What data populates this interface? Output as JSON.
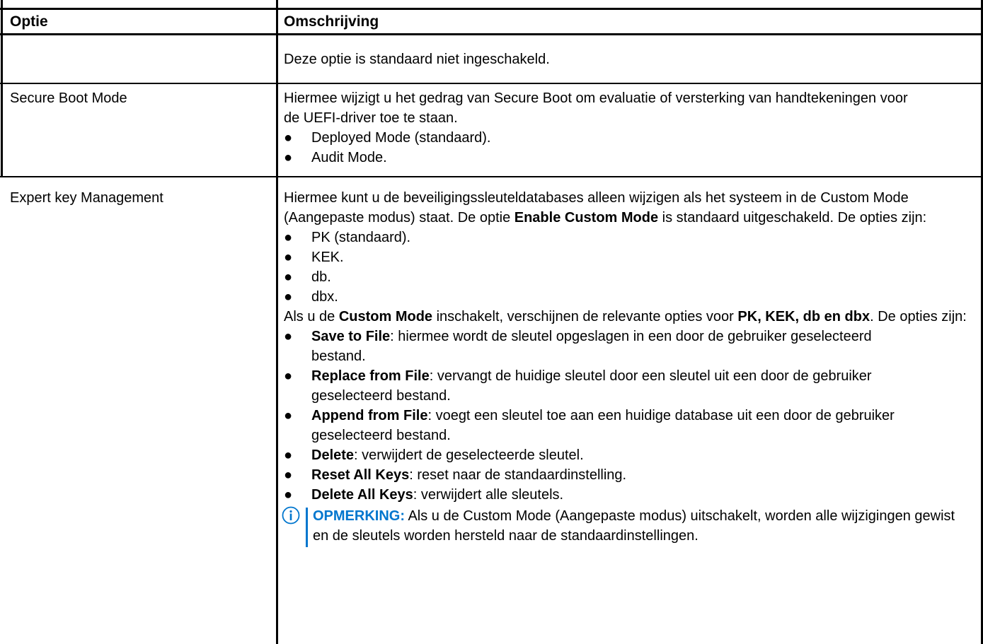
{
  "table": {
    "headers": {
      "option": "Optie",
      "description": "Omschrijving"
    },
    "rows": [
      {
        "option": "",
        "desc_text": "Deze optie is standaard niet ingeschakeld."
      },
      {
        "option": "Secure Boot Mode",
        "desc_text": "Hiermee wijzigt u het gedrag van Secure Boot om evaluatie of versterking van handtekeningen voor de UEFI-driver toe te staan.",
        "bullets": [
          "Deployed Mode (standaard).",
          "Audit Mode."
        ]
      },
      {
        "option": "Expert key Management",
        "intro_1": "Hiermee kunt u de beveiligingssleuteldatabases alleen wijzigen als het systeem in de Custom Mode (Aangepaste modus) staat. De optie ",
        "intro_bold": "Enable Custom Mode",
        "intro_2": " is standaard uitgeschakeld. De opties zijn:",
        "key_bullets": [
          "PK (standaard).",
          "KEK.",
          "db.",
          "dbx."
        ],
        "mid_1": "Als u de ",
        "mid_bold_1": "Custom Mode",
        "mid_2": " inschakelt, verschijnen de relevante opties voor ",
        "mid_bold_2": "PK, KEK, db en dbx",
        "mid_3": ". De opties zijn:",
        "action_bullets": [
          {
            "term": "Save to File",
            "text": ": hiermee wordt de sleutel opgeslagen in een door de gebruiker geselecteerd bestand."
          },
          {
            "term": "Replace from File",
            "text": ": vervangt de huidige sleutel door een sleutel uit een door de gebruiker geselecteerd bestand."
          },
          {
            "term": "Append from File",
            "text": ": voegt een sleutel toe aan een huidige database uit een door de gebruiker geselecteerd bestand."
          },
          {
            "term": "Delete",
            "text": ": verwijdert de geselecteerde sleutel."
          },
          {
            "term": "Reset All Keys",
            "text": ": reset naar de standaardinstelling."
          },
          {
            "term": "Delete All Keys",
            "text": ": verwijdert alle sleutels."
          }
        ],
        "note": {
          "icon": "info-circle-icon",
          "label": "OPMERKING:",
          "text": " Als u de Custom Mode (Aangepaste modus) uitschakelt, worden alle wijzigingen gewist en de sleutels worden hersteld naar de standaardinstellingen."
        }
      }
    ]
  },
  "colors": {
    "border": "#000000",
    "header_bg": "#ffffff",
    "note_accent": "#0076ce"
  }
}
